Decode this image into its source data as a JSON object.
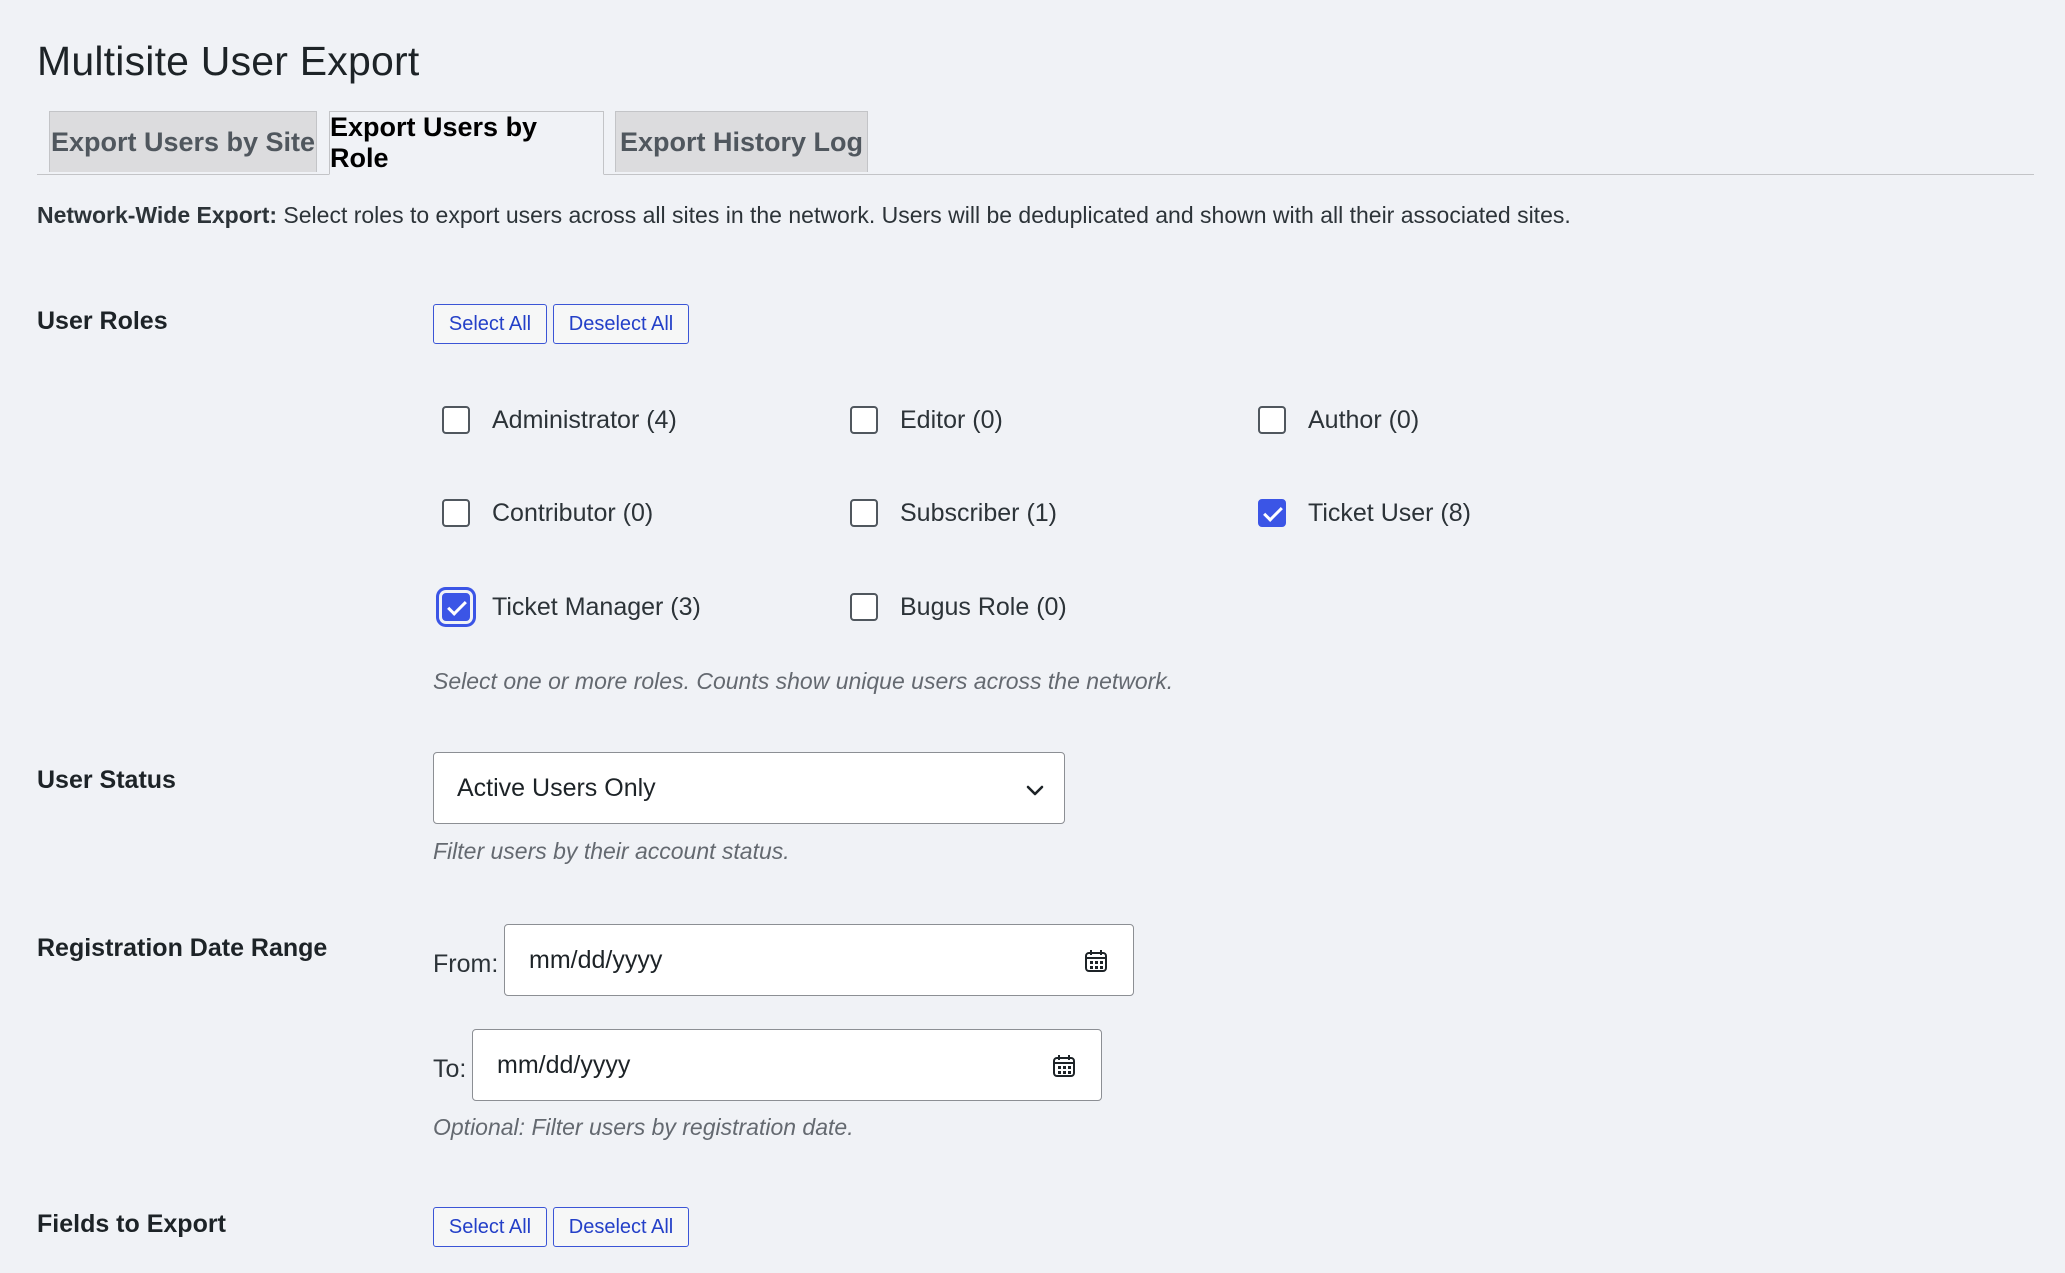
{
  "page_title": "Multisite User Export",
  "tabs": [
    {
      "label": "Export Users by Site",
      "active": false
    },
    {
      "label": "Export Users by Role",
      "active": true
    },
    {
      "label": "Export History Log",
      "active": false
    }
  ],
  "description": {
    "strong": "Network-Wide Export:",
    "text": " Select roles to export users across all sites in the network. Users will be deduplicated and shown with all their associated sites."
  },
  "user_roles": {
    "label": "User Roles",
    "select_all": "Select All",
    "deselect_all": "Deselect All",
    "roles": [
      {
        "label": "Administrator (4)",
        "checked": false
      },
      {
        "label": "Editor (0)",
        "checked": false
      },
      {
        "label": "Author (0)",
        "checked": false
      },
      {
        "label": "Contributor (0)",
        "checked": false
      },
      {
        "label": "Subscriber (1)",
        "checked": false
      },
      {
        "label": "Ticket User (8)",
        "checked": true
      },
      {
        "label": "Ticket Manager (3)",
        "checked": true
      },
      {
        "label": "Bugus Role (0)",
        "checked": false
      }
    ],
    "hint": "Select one or more roles. Counts show unique users across the network."
  },
  "user_status": {
    "label": "User Status",
    "selected": "Active Users Only",
    "hint": "Filter users by their account status."
  },
  "registration_date": {
    "label": "Registration Date Range",
    "from_label": "From:",
    "to_label": "To:",
    "from_placeholder": "mm/dd/yyyy",
    "to_placeholder": "mm/dd/yyyy",
    "hint": "Optional: Filter users by registration date."
  },
  "fields_to_export": {
    "label": "Fields to Export",
    "select_all": "Select All",
    "deselect_all": "Deselect All"
  },
  "colors": {
    "accent": "#3b55e6",
    "background": "#f0f2f6"
  }
}
